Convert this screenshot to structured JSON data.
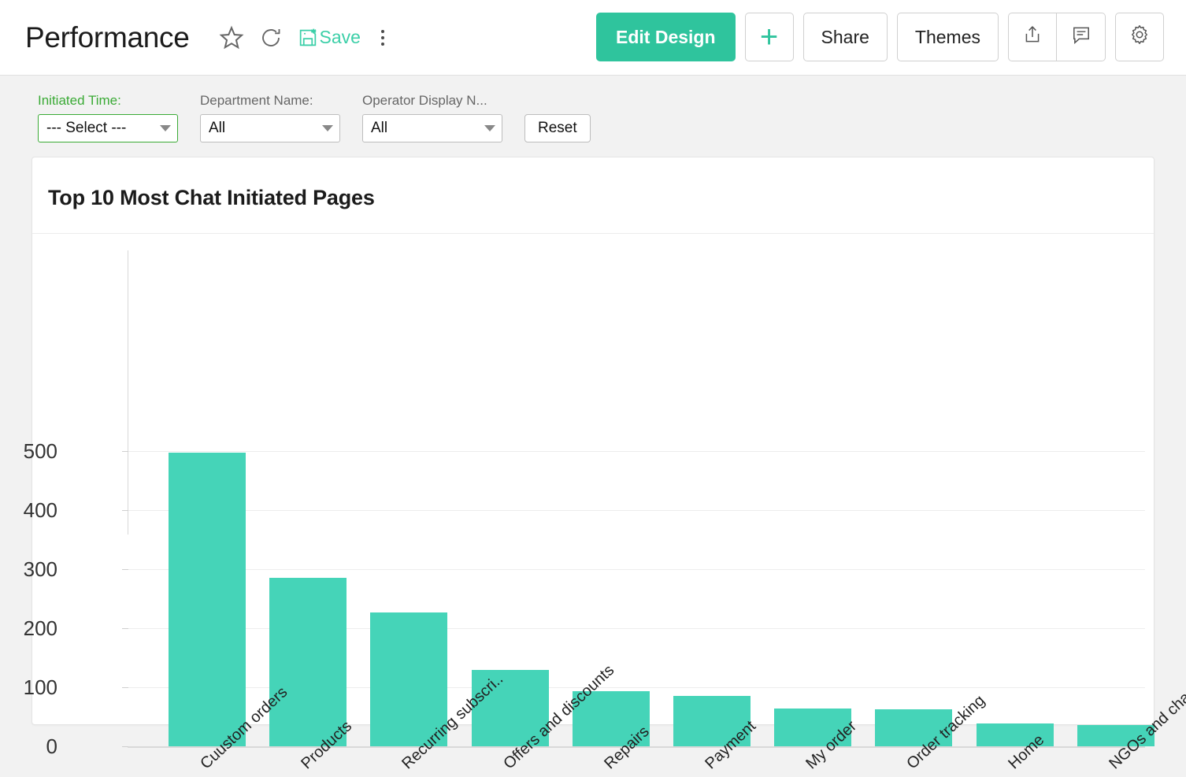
{
  "header": {
    "title": "Performance",
    "tools": [
      {
        "name": "favorite-icon",
        "label": "Favorite"
      },
      {
        "name": "refresh-icon",
        "label": "Refresh"
      },
      {
        "name": "save-icon",
        "label": "Save"
      },
      {
        "name": "more-options-icon",
        "label": "More options"
      }
    ],
    "save_label": "Save",
    "actions": {
      "edit_design": "Edit Design",
      "add": "+",
      "share": "Share",
      "themes": "Themes",
      "export": "export-icon",
      "comment": "comment-icon",
      "settings": "gear-icon"
    }
  },
  "filters": [
    {
      "label": "Initiated Time:",
      "value": "--- Select ---",
      "active": true
    },
    {
      "label": "Department Name:",
      "value": "All",
      "active": false
    },
    {
      "label": "Operator Display N...",
      "value": "All",
      "active": false
    }
  ],
  "reset_label": "Reset",
  "chart_card": {
    "title": "Top 10 Most Chat Initiated Pages"
  },
  "colors": {
    "accent": "#2fc49d",
    "bar": "#45d4b8",
    "active_filter": "#3aaa35",
    "save_text": "#3ccfa8"
  },
  "chart_data": {
    "type": "bar",
    "title": "Top 10 Most Chat Initiated Pages",
    "xlabel": "",
    "ylabel": "",
    "ylim": [
      0,
      500
    ],
    "yticks": [
      0,
      100,
      200,
      300,
      400,
      500
    ],
    "grid": true,
    "legend": false,
    "categories": [
      "Cuustom orders",
      "Products",
      "Recurring subscri..",
      "Offers and discounts",
      "Repairs",
      "Payment",
      "My order",
      "Order tracking",
      "Home",
      "NGOs and charity"
    ],
    "values": [
      497,
      285,
      227,
      129,
      93,
      85,
      64,
      63,
      39,
      36
    ]
  }
}
